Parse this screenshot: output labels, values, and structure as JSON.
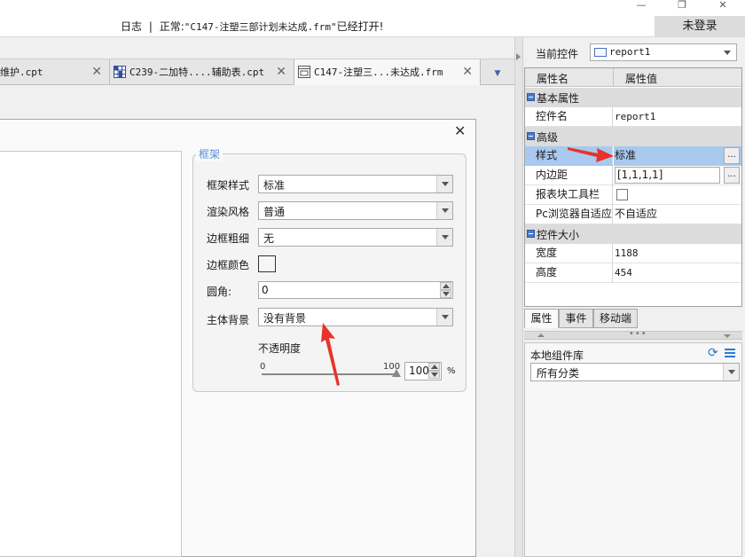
{
  "titlebar": {
    "log_label": "日志",
    "separator": "|",
    "status_prefix": "正常:",
    "status_file": "\"C147-注塑三部计划未达成.frm\"",
    "status_suffix": "已经打开!",
    "login_label": "未登录",
    "minimize_glyph": "—",
    "restore_glyph": "❐",
    "close_glyph": "✕"
  },
  "tabs": [
    {
      "label": "维护.cpt",
      "close": "✕",
      "active": false
    },
    {
      "label": "C239-二加特....辅助表.cpt",
      "close": "✕",
      "active": false
    },
    {
      "label": "C147-注塑三...未达成.frm",
      "close": "✕",
      "active": true
    }
  ],
  "tab_menu_glyph": "▼",
  "dialog": {
    "close_glyph": "✕",
    "frame": {
      "legend": "框架",
      "frame_style_label": "框架样式",
      "frame_style_value": "标准",
      "render_style_label": "渲染风格",
      "render_style_value": "普通",
      "border_width_label": "边框粗细",
      "border_width_value": "无",
      "border_color_label": "边框颜色",
      "corner_label": "圆角:",
      "corner_value": "0",
      "body_bg_label": "主体背景",
      "body_bg_value": "没有背景",
      "opacity_label": "不透明度",
      "slider_min": "0",
      "slider_max": "100",
      "opacity_value": "100",
      "opacity_unit": "%",
      "opacity_level": 100
    }
  },
  "right_panel": {
    "current_control_label": "当前控件",
    "current_control_value": "report1",
    "header_name": "属性名",
    "header_value": "属性值",
    "sections": {
      "basic": "基本属性",
      "advanced": "高级",
      "size": "控件大小"
    },
    "rows": {
      "control_name_label": "控件名",
      "control_name_value": "report1",
      "style_label": "样式",
      "style_value": "标准",
      "padding_label": "内边距",
      "padding_value": "[1,1,1,1]",
      "toolbar_label": "报表块工具栏",
      "pc_adapt_label": "Pc浏览器自适应",
      "pc_adapt_value": "不自适应",
      "width_label": "宽度",
      "width_value": "1188",
      "height_label": "高度",
      "height_value": "454",
      "ellipsis": "..."
    },
    "bottom_tabs": [
      "属性",
      "事件",
      "移动端"
    ],
    "separator_dots": "•••",
    "library_title": "本地组件库",
    "library_category": "所有分类"
  },
  "colors": {
    "annotation_arrow": "#e8322b",
    "selected_row": "#a9c9ee",
    "section_icon": "#4a7cc9",
    "legend_text": "#5b8fd1",
    "refresh_icon": "#2a7ad6"
  }
}
